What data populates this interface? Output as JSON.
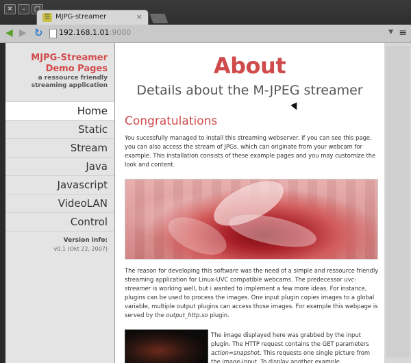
{
  "window": {
    "tab_title": "MJPG-streamer",
    "tab_close": "×",
    "url_host": "192.168.1.01",
    "url_port": ":9000"
  },
  "sidebar": {
    "title_line1": "MJPG-Streamer",
    "title_line2": "Demo Pages",
    "subtitle_line1": "a ressource friendly",
    "subtitle_line2": "streaming application",
    "nav": [
      "Home",
      "Static",
      "Stream",
      "Java",
      "Javascript",
      "VideoLAN",
      "Control"
    ],
    "active_index": 0,
    "version_title": "Version info:",
    "version_text": "v0.1 (Okt 22, 2007)"
  },
  "content": {
    "title": "About",
    "subtitle": "Details about the M-JPEG streamer",
    "section_title": "Congratulations",
    "para1": "You sucessfully managed to install this streaming webserver. If you can see this page, you can also access the stream of JPGs, which can originate from your webcam for example. This installation consists of these example pages and you may customize the look and content.",
    "para2_a": "The reason for developing this software was the need of a simple and ressource friendly streaming application for Linux-UVC compatible webcams. The predecessor ",
    "para2_em": "uvc-streamer",
    "para2_b": " is working well, but i wanted to implement a few more ideas. For instance, plugins can be used to process the images. One input plugin copies images to a global variable, multiple output plugins can access those images. For example this webpage is served by the ",
    "para2_em2": "output_http.so",
    "para2_c": " plugin.",
    "para3_a": "The image displayed here was grabbed by the input plugin. The HTTP request contains the GET parameters ",
    "para3_em": "action=snapshot",
    "para3_b": ". This requests one single picture from the image-input. To display another example."
  },
  "colors": {
    "accent": "#cf4a4a",
    "sidebar_bg": "#e4e4e4",
    "chrome_bg": "#2e2e2e"
  },
  "icons": [
    "close-icon",
    "minimize-icon",
    "maximize-icon",
    "favicon-icon",
    "back-arrow-icon",
    "forward-arrow-icon",
    "reload-icon",
    "page-icon",
    "menu-icon"
  ]
}
